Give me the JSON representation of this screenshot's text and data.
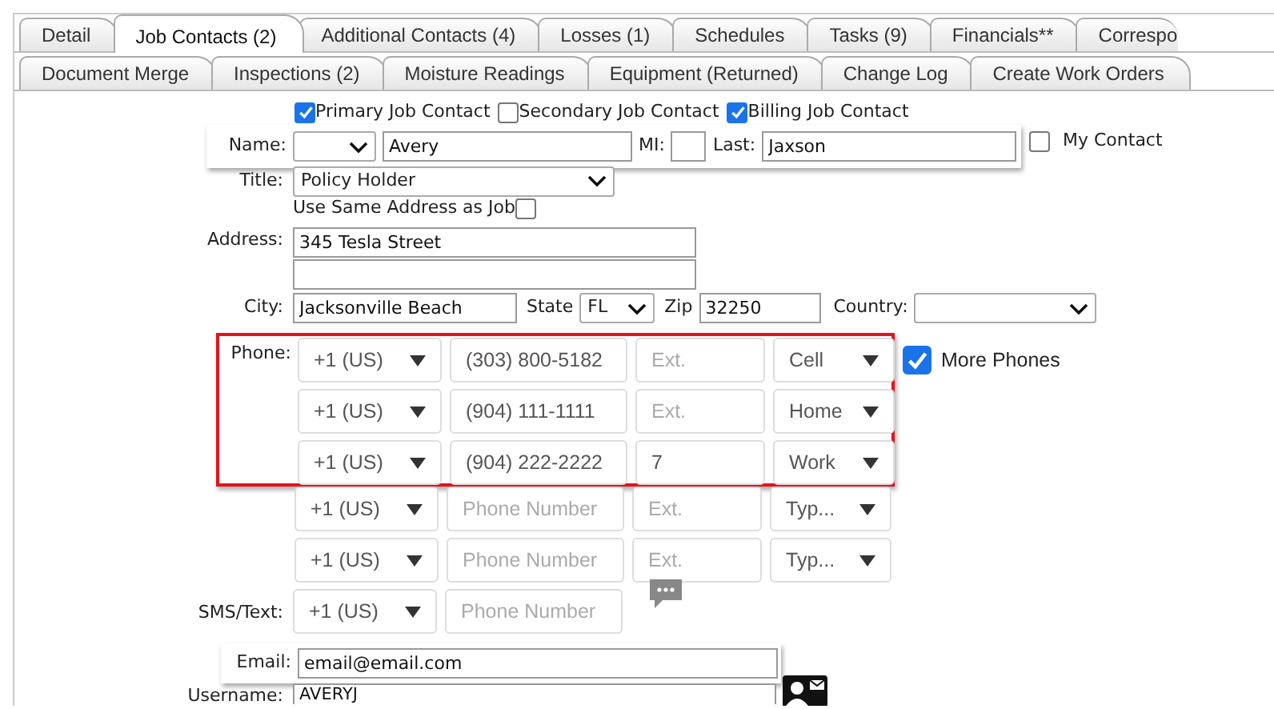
{
  "tabs_row_1": [
    {
      "label": "Detail",
      "selected": false
    },
    {
      "label": "Job Contacts (2)",
      "selected": true
    },
    {
      "label": "Additional Contacts (4)",
      "selected": false
    },
    {
      "label": "Losses (1)",
      "selected": false
    },
    {
      "label": "Schedules",
      "selected": false
    },
    {
      "label": "Tasks (9)",
      "selected": false
    },
    {
      "label": "Financials**",
      "selected": false
    },
    {
      "label": "Correspo",
      "selected": false
    }
  ],
  "tabs_row_2": [
    {
      "label": "Document Merge",
      "selected": false
    },
    {
      "label": "Inspections (2)",
      "selected": false
    },
    {
      "label": "Moisture Readings",
      "selected": false
    },
    {
      "label": "Equipment (Returned)",
      "selected": false
    },
    {
      "label": "Change Log",
      "selected": false
    },
    {
      "label": "Create Work Orders",
      "selected": false
    }
  ],
  "contact_roles": [
    {
      "label": "Primary Job Contact",
      "checked": true
    },
    {
      "label": "Secondary Job Contact",
      "checked": false
    },
    {
      "label": "Billing Job Contact",
      "checked": true
    }
  ],
  "name": {
    "label": "Name:",
    "first": "Avery",
    "mi_label": "MI:",
    "last_label": "Last:",
    "last": "Jaxson",
    "highlighted": true
  },
  "my_contact": {
    "label": "My Contact",
    "checked": false
  },
  "title": {
    "label": "Title:",
    "value": "Policy Holder"
  },
  "same_address": {
    "label": "Use Same Address as Job",
    "checked": false
  },
  "address": {
    "label": "Address:",
    "line_1": "345 Tesla Street"
  },
  "city": {
    "label": "City:",
    "value": "Jacksonville Beach",
    "state_label": "State",
    "state": "FL",
    "zip_label": "Zip",
    "zip": "32250",
    "country_label": "Country:"
  },
  "phone_label": "Phone:",
  "phones": [
    {
      "country": "+1 (US)",
      "number": "(303) 800-5182",
      "ext_placeholder": "Ext.",
      "type": "Cell",
      "highlighted": true
    },
    {
      "country": "+1 (US)",
      "number": "(904) 111-1111",
      "ext_placeholder": "Ext.",
      "type": "Home",
      "highlighted": true
    },
    {
      "country": "+1 (US)",
      "number": "(904) 222-2222",
      "ext": "7",
      "type": "Work",
      "highlighted": true
    },
    {
      "country": "+1 (US)",
      "number_placeholder": "Phone Number",
      "ext_placeholder": "Ext.",
      "type": "Typ...",
      "highlighted": false
    },
    {
      "country": "+1 (US)",
      "number_placeholder": "Phone Number",
      "ext_placeholder": "Ext.",
      "type": "Typ...",
      "highlighted": false
    }
  ],
  "more_phones": {
    "label": "More Phones",
    "checked": true
  },
  "sms": {
    "label": "SMS/Text:",
    "country": "+1 (US)",
    "number_placeholder": "Phone Number"
  },
  "email": {
    "label": "Email:",
    "value": "email@email.com",
    "highlighted": true
  },
  "username": {
    "label": "Username:",
    "value": "AVERYJ"
  }
}
